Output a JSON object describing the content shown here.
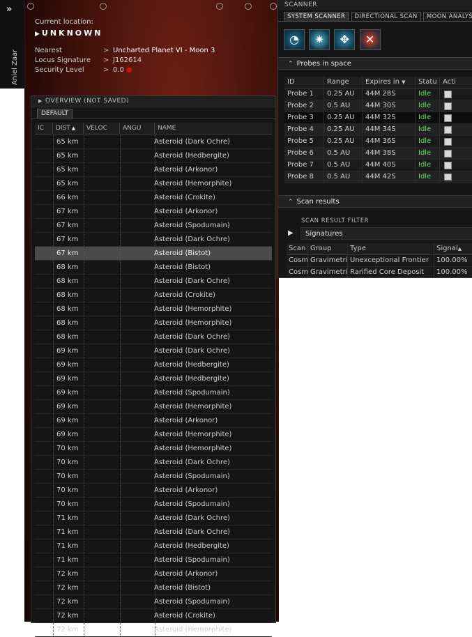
{
  "neocom": {
    "expand_icon": "double-chevron-right-icon",
    "expand_glyph": "»",
    "character": "Aniel Zaar"
  },
  "location": {
    "current_label": "Current location:",
    "system": "UNKNOWN",
    "nearest_label": "Nearest",
    "nearest_value": "Uncharted Planet VI - Moon 3",
    "locus_label": "Locus Signature",
    "locus_value": "J162614",
    "security_label": "Security Level",
    "security_value": "0.0",
    "security_color": "#d01010"
  },
  "overview": {
    "title": "OVERVIEW (NOT SAVED)",
    "tab": "DEFAULT",
    "columns": {
      "icon": "IC",
      "distance": "DIST",
      "velocity": "VELOC",
      "angular": "ANGU",
      "name": "NAME"
    },
    "rows": [
      {
        "dist": "65 km",
        "name": "Asteroid (Dark Ochre)"
      },
      {
        "dist": "65 km",
        "name": "Asteroid (Hedbergite)"
      },
      {
        "dist": "65 km",
        "name": "Asteroid (Arkonor)"
      },
      {
        "dist": "65 km",
        "name": "Asteroid (Hemorphite)"
      },
      {
        "dist": "66 km",
        "name": "Asteroid (Crokite)"
      },
      {
        "dist": "67 km",
        "name": "Asteroid (Arkonor)"
      },
      {
        "dist": "67 km",
        "name": "Asteroid (Spodumain)"
      },
      {
        "dist": "67 km",
        "name": "Asteroid (Dark Ochre)"
      },
      {
        "dist": "67 km",
        "name": "Asteroid (Bistot)",
        "selected": true
      },
      {
        "dist": "68 km",
        "name": "Asteroid (Bistot)"
      },
      {
        "dist": "68 km",
        "name": "Asteroid (Dark Ochre)"
      },
      {
        "dist": "68 km",
        "name": "Asteroid (Crokite)"
      },
      {
        "dist": "68 km",
        "name": "Asteroid (Hemorphite)"
      },
      {
        "dist": "68 km",
        "name": "Asteroid (Hemorphite)"
      },
      {
        "dist": "68 km",
        "name": "Asteroid (Dark Ochre)"
      },
      {
        "dist": "69 km",
        "name": "Asteroid (Dark Ochre)"
      },
      {
        "dist": "69 km",
        "name": "Asteroid (Hedbergite)"
      },
      {
        "dist": "69 km",
        "name": "Asteroid (Hedbergite)"
      },
      {
        "dist": "69 km",
        "name": "Asteroid (Spodumain)"
      },
      {
        "dist": "69 km",
        "name": "Asteroid (Hemorphite)"
      },
      {
        "dist": "69 km",
        "name": "Asteroid (Arkonor)"
      },
      {
        "dist": "69 km",
        "name": "Asteroid (Hemorphite)"
      },
      {
        "dist": "70 km",
        "name": "Asteroid (Hemorphite)"
      },
      {
        "dist": "70 km",
        "name": "Asteroid (Dark Ochre)"
      },
      {
        "dist": "70 km",
        "name": "Asteroid (Spodumain)"
      },
      {
        "dist": "70 km",
        "name": "Asteroid (Arkonor)"
      },
      {
        "dist": "70 km",
        "name": "Asteroid (Spodumain)"
      },
      {
        "dist": "71 km",
        "name": "Asteroid (Dark Ochre)"
      },
      {
        "dist": "71 km",
        "name": "Asteroid (Dark Ochre)"
      },
      {
        "dist": "71 km",
        "name": "Asteroid (Hedbergite)"
      },
      {
        "dist": "71 km",
        "name": "Asteroid (Spodumain)"
      },
      {
        "dist": "72 km",
        "name": "Asteroid (Arkonor)"
      },
      {
        "dist": "72 km",
        "name": "Asteroid (Bistot)"
      },
      {
        "dist": "72 km",
        "name": "Asteroid (Spodumain)"
      },
      {
        "dist": "72 km",
        "name": "Asteroid (Crokite)"
      },
      {
        "dist": "72 km",
        "name": "Asteroid (Hemorphite)"
      }
    ]
  },
  "scanner": {
    "title": "SCANNER",
    "tabs": [
      "SYSTEM SCANNER",
      "DIRECTIONAL SCAN",
      "MOON ANALYS"
    ],
    "tools": [
      "analyze-icon",
      "spread-icon",
      "pinpoint-icon",
      "recall-icon"
    ],
    "probes_title": "Probes in space",
    "probe_columns": {
      "id": "ID",
      "range": "Range",
      "expires": "Expires in",
      "status": "Statu",
      "action": "Acti"
    },
    "probes": [
      {
        "id": "Probe 1",
        "range": "0.25 AU",
        "expires": "44M 28S",
        "status": "Idle"
      },
      {
        "id": "Probe 2",
        "range": "0.5 AU",
        "expires": "44M 30S",
        "status": "Idle"
      },
      {
        "id": "Probe 3",
        "range": "0.25 AU",
        "expires": "44M 32S",
        "status": "Idle"
      },
      {
        "id": "Probe 4",
        "range": "0.25 AU",
        "expires": "44M 34S",
        "status": "Idle"
      },
      {
        "id": "Probe 5",
        "range": "0.25 AU",
        "expires": "44M 36S",
        "status": "Idle"
      },
      {
        "id": "Probe 6",
        "range": "0.5 AU",
        "expires": "44M 38S",
        "status": "Idle"
      },
      {
        "id": "Probe 7",
        "range": "0.5 AU",
        "expires": "44M 40S",
        "status": "Idle"
      },
      {
        "id": "Probe 8",
        "range": "0.5 AU",
        "expires": "44M 42S",
        "status": "Idle"
      }
    ],
    "results_title": "Scan results",
    "filter_label": "SCAN RESULT FILTER",
    "filter_value": "Signatures",
    "result_columns": {
      "scan": "Scan",
      "group": "Group",
      "type": "Type",
      "signal": "Signal"
    },
    "results": [
      {
        "scan": "Cosm",
        "group": "Gravimetri",
        "type": "Unexceptional Frontier",
        "signal": "100.00%"
      },
      {
        "scan": "Cosm",
        "group": "Gravimetri",
        "type": "Rarified Core Deposit",
        "signal": "100.00%"
      }
    ],
    "idle_color": "#58e858"
  }
}
